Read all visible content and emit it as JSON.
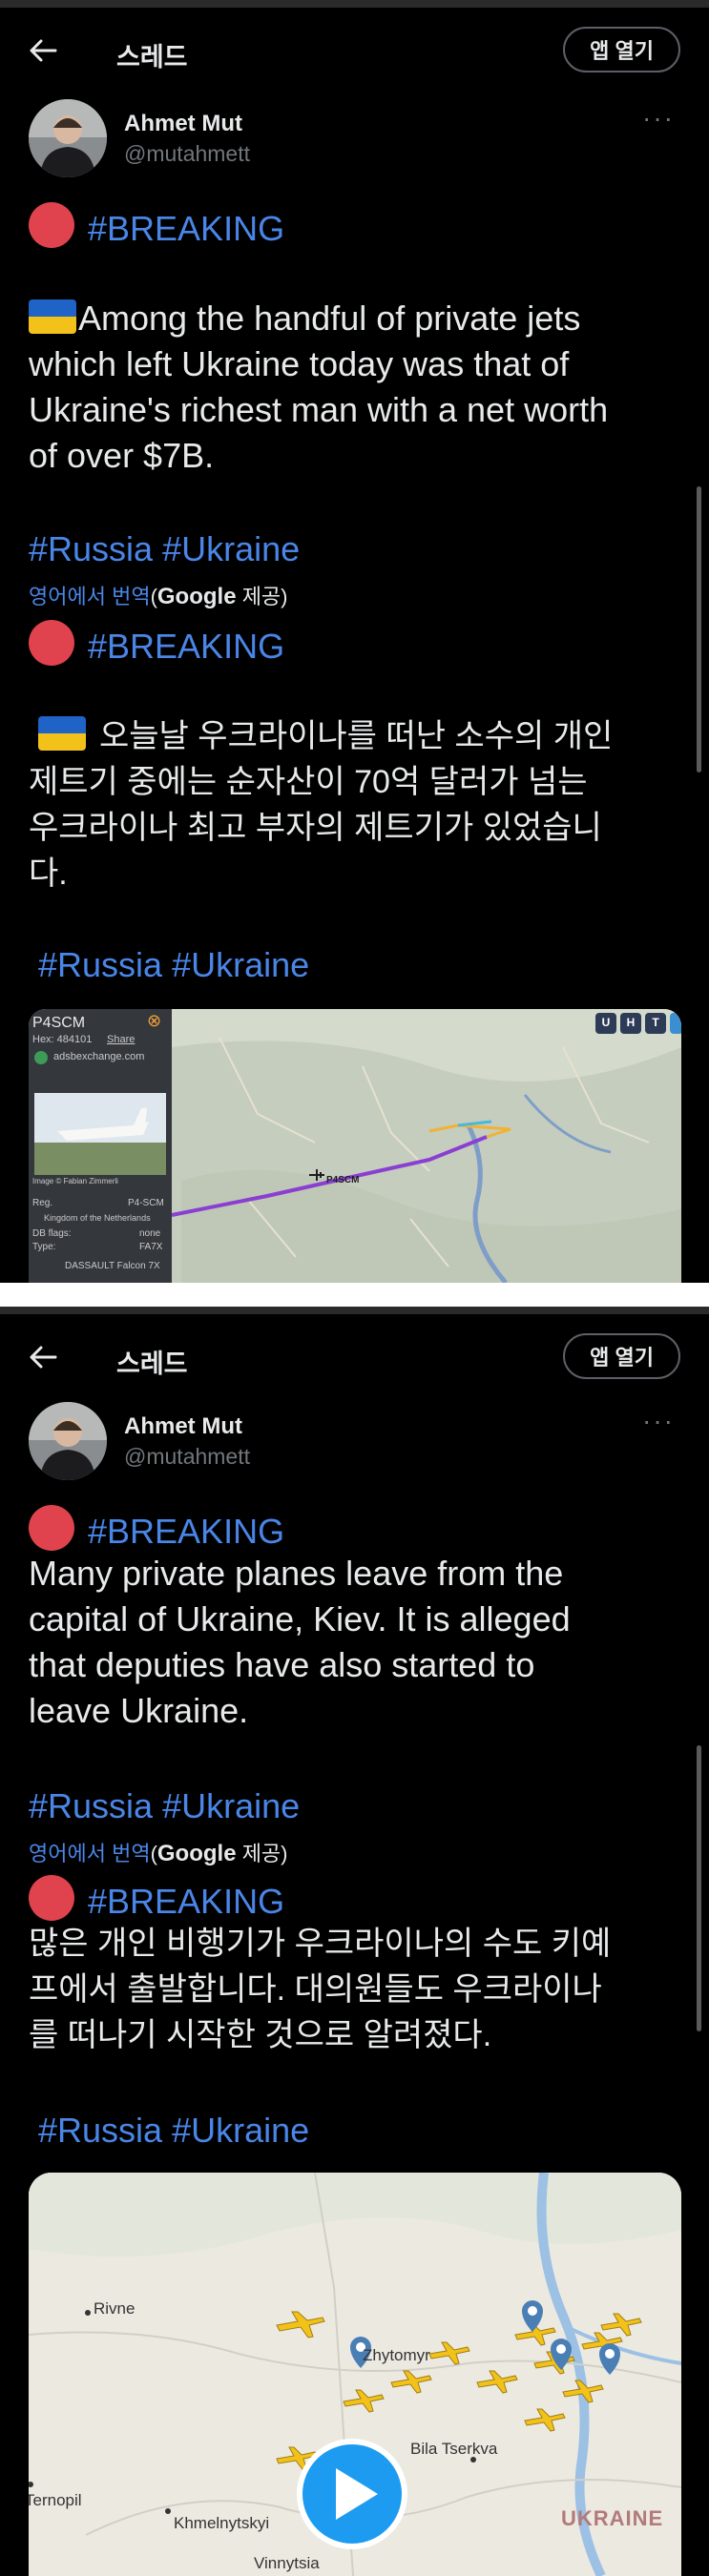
{
  "header": {
    "title": "스레드",
    "open_app_label": "앱 열기"
  },
  "tweet1": {
    "user_name": "Ahmet Mut",
    "user_handle": "@mutahmett",
    "breaking": "#BREAKING",
    "text_lines": [
      "Among the handful of private jets",
      "which left Ukraine today was that of",
      "Ukraine's richest man with a net worth",
      "of over $7B."
    ],
    "hashtags": "#Russia #Ukraine",
    "translate_prefix": "영어에서 번역",
    "translate_provider_open": "(",
    "translate_provider": "Google",
    "translate_provider_close": "제공)",
    "translated_breaking": "#BREAKING",
    "translated_lines": [
      "오늘날 우크라이나를 떠난 소수의 개인",
      "제트기 중에는 순자산이 70억 달러가 넘는",
      "우크라이나 최고 부자의 제트기가 있었습니",
      "다."
    ],
    "translated_hashtags": "#Russia #Ukraine",
    "media": {
      "callsign": "P4SCM",
      "hex": "Hex: 484101",
      "share": "Share",
      "source": "adsbexchange.com",
      "image_credit": "Image © Fabian Zimmerli",
      "reg_label": "Reg.",
      "reg_value": "P4-SCM",
      "country": "Kingdom of the Netherlands",
      "db_flags_label": "DB flags:",
      "db_flags_value": "none",
      "type_label": "Type:",
      "type_value": "FA7X",
      "aircraft": "DASSAULT Falcon 7X",
      "map_label": "P4SCM",
      "map_buttons": [
        "U",
        "H",
        "T"
      ]
    }
  },
  "tweet2": {
    "user_name": "Ahmet Mut",
    "user_handle": "@mutahmett",
    "breaking": "#BREAKING",
    "text_lines": [
      "Many private planes leave from the",
      "capital of Ukraine, Kiev. It is alleged",
      "that deputies have also started to",
      "leave Ukraine."
    ],
    "hashtags": "#Russia #Ukraine",
    "translate_prefix": "영어에서 번역",
    "translate_provider_open": "(",
    "translate_provider": "Google",
    "translate_provider_close": "제공)",
    "translated_breaking": "#BREAKING",
    "translated_lines": [
      " 많은 개인 비행기가 우크라이나의 수도 키예",
      "프에서 출발합니다. 대의원들도 우크라이나",
      "를 떠나기 시작한 것으로 알려졌다."
    ],
    "translated_hashtags": "#Russia #Ukraine",
    "map_places": [
      "Rivne",
      "Zhytomyr",
      "Bila Tserkva",
      "Ternopil",
      "Khmelnytskyi",
      "Vinnytsia",
      "UKRAINE"
    ]
  },
  "colors": {
    "background": "#000000",
    "hashtag": "#4a86e8",
    "red_dot": "#e0434e",
    "flag_blue": "#1f63c6",
    "flag_yellow": "#f2c21b"
  }
}
